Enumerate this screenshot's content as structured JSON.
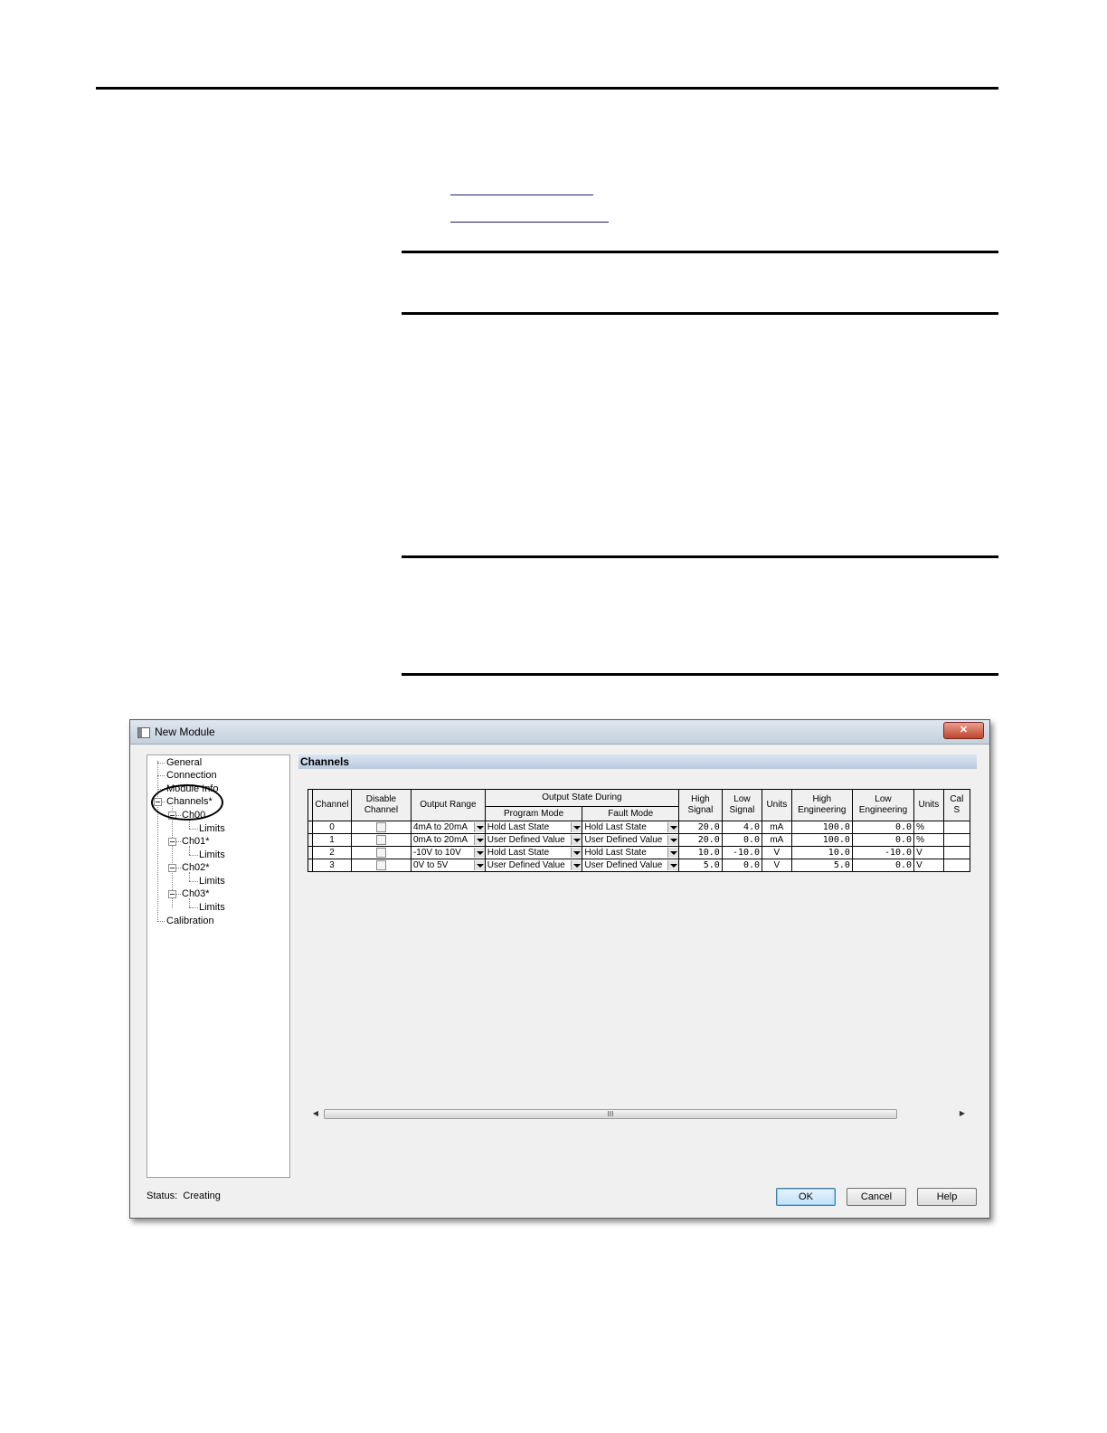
{
  "dialog": {
    "title": "New Module",
    "close_glyph": "✕",
    "section_title": "Channels",
    "status_label": "Status:",
    "status_value": "Creating"
  },
  "tree": {
    "items": [
      {
        "label": "General"
      },
      {
        "label": "Connection"
      },
      {
        "label": "Module Info"
      },
      {
        "label": "Channels*"
      },
      {
        "label": "Ch00"
      },
      {
        "label": "Limits"
      },
      {
        "label": "Ch01*"
      },
      {
        "label": "Limits"
      },
      {
        "label": "Ch02*"
      },
      {
        "label": "Limits"
      },
      {
        "label": "Ch03*"
      },
      {
        "label": "Limits"
      },
      {
        "label": "Calibration"
      }
    ]
  },
  "grid": {
    "headers": {
      "channel": "Channel",
      "disable_channel": "Disable Channel",
      "output_range": "Output Range",
      "output_state_during": "Output State During",
      "program_mode": "Program Mode",
      "fault_mode": "Fault Mode",
      "high_signal": "High Signal",
      "low_signal": "Low Signal",
      "units": "Units",
      "high_engineering": "High Engineering",
      "low_engineering": "Low Engineering",
      "units2": "Units",
      "cal": "Cal S"
    },
    "rows": [
      {
        "channel": "0",
        "output_range": "4mA to 20mA",
        "program_mode": "Hold Last State",
        "fault_mode": "Hold Last State",
        "high_signal": "20.0",
        "low_signal": "4.0",
        "units": "mA",
        "high_eng": "100.0",
        "low_eng": "0.0",
        "units2": "%"
      },
      {
        "channel": "1",
        "output_range": "0mA to 20mA",
        "program_mode": "User Defined Value",
        "fault_mode": "User Defined Value",
        "high_signal": "20.0",
        "low_signal": "0.0",
        "units": "mA",
        "high_eng": "100.0",
        "low_eng": "0.0",
        "units2": "%"
      },
      {
        "channel": "2",
        "output_range": "-10V to 10V",
        "program_mode": "Hold Last State",
        "fault_mode": "Hold Last State",
        "high_signal": "10.0",
        "low_signal": "-10.0",
        "units": "V",
        "high_eng": "10.0",
        "low_eng": "-10.0",
        "units2": "V"
      },
      {
        "channel": "3",
        "output_range": "0V to 5V",
        "program_mode": "User Defined Value",
        "fault_mode": "User Defined Value",
        "high_signal": "5.0",
        "low_signal": "0.0",
        "units": "V",
        "high_eng": "5.0",
        "low_eng": "0.0",
        "units2": "V"
      }
    ]
  },
  "scrollbar": {
    "left_arrow": "◀",
    "right_arrow": "▶",
    "grip": "III"
  },
  "buttons": {
    "ok": "OK",
    "cancel": "Cancel",
    "help": "Help"
  }
}
